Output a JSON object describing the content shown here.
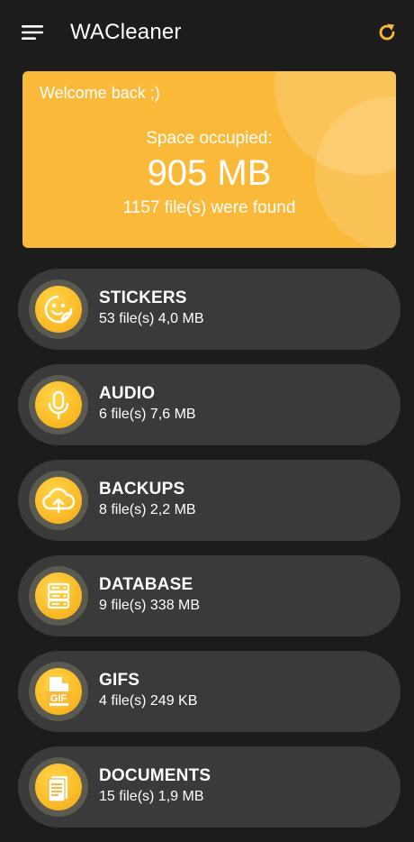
{
  "app": {
    "title": "WACleaner"
  },
  "icons": {
    "menu": "menu-icon",
    "refresh": "refresh-icon"
  },
  "colors": {
    "accent": "#fbb93a",
    "refresh": "#fbb93a",
    "background": "#1c1c1c",
    "item_background": "#3a3a3a"
  },
  "summary": {
    "welcome": "Welcome back ;)",
    "space_label": "Space occupied:",
    "space_value": "905 MB",
    "files_found": "1157 file(s) were found"
  },
  "categories": [
    {
      "title": "STICKERS",
      "subtitle": "53 file(s) 4,0 MB",
      "icon": "sticker-icon"
    },
    {
      "title": "AUDIO",
      "subtitle": "6 file(s) 7,6 MB",
      "icon": "microphone-icon"
    },
    {
      "title": "BACKUPS",
      "subtitle": "8 file(s) 2,2 MB",
      "icon": "cloud-upload-icon"
    },
    {
      "title": "DATABASE",
      "subtitle": "9 file(s) 338 MB",
      "icon": "database-icon"
    },
    {
      "title": "GIFS",
      "subtitle": "4 file(s) 249 KB",
      "icon": "gif-file-icon"
    },
    {
      "title": "DOCUMENTS",
      "subtitle": "15 file(s) 1,9 MB",
      "icon": "document-icon"
    }
  ]
}
